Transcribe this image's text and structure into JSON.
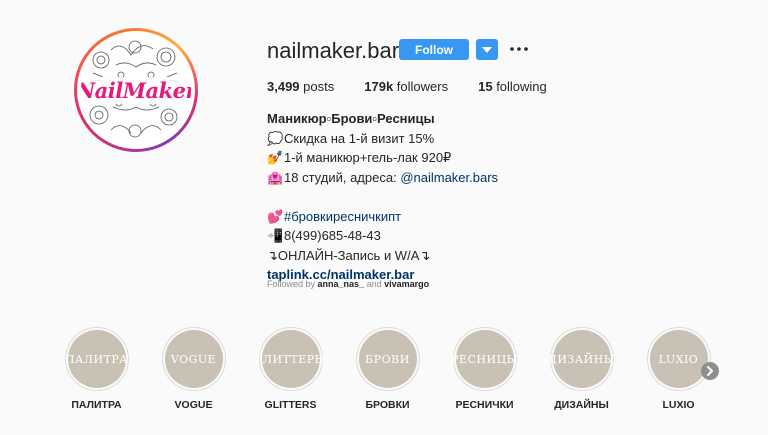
{
  "profile": {
    "username": "nailmaker.bar",
    "avatar_text": "NailMaker",
    "follow_label": "Follow",
    "stats": {
      "posts_count": "3,499",
      "posts_label": "posts",
      "followers_count": "179k",
      "followers_label": "followers",
      "following_count": "15",
      "following_label": "following"
    }
  },
  "bio": {
    "name": "Маникюр▫Брови▫Ресницы",
    "line1": "Скидка на 1-й визит 15%",
    "line2": "1-й маникюр+гель-лак 920₽",
    "line3_prefix": "18 студий, адреса: ",
    "line3_mention": "@nailmaker.bars",
    "line4": "#бровкиресничкипт",
    "line5": "8(499)685-48-43",
    "line6": "ОНЛАЙН-Запись и W/A",
    "link": "taplink.cc/nailmaker.bar"
  },
  "followed_by": {
    "prefix": "Followed by ",
    "user1": "anna_nas_",
    "sep": " and ",
    "user2": "vivamargo"
  },
  "highlights": [
    {
      "cover": "ПАЛИТРА",
      "label": "ПАЛИТРА"
    },
    {
      "cover": "VOGUE",
      "label": "VOGUE"
    },
    {
      "cover": "ГЛИТТЕРЫ",
      "label": "GLITTERS"
    },
    {
      "cover": "БРОВИ",
      "label": "БРОВКИ"
    },
    {
      "cover": "РЕСНИЦЫ",
      "label": "РЕСНИЧКИ"
    },
    {
      "cover": "ДИЗАЙНЫ",
      "label": "ДИЗАЙНЫ"
    },
    {
      "cover": "LUXIO",
      "label": "LUXIO"
    }
  ],
  "colors": {
    "follow_button": "#3897f0",
    "highlight_cover": "#c9c1b4",
    "link": "#003569",
    "brand_pink": "#e6197e"
  },
  "icons": {
    "more": "more-dots-icon",
    "dropdown": "chevron-down-icon",
    "next": "chevron-right-icon"
  }
}
